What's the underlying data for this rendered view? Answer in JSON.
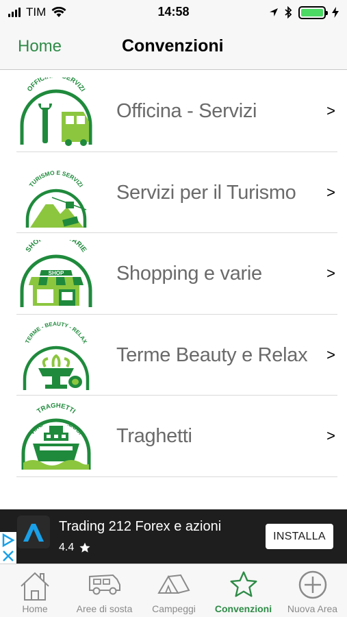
{
  "status_bar": {
    "carrier": "TIM",
    "time": "14:58",
    "battery_color": "#4cd964"
  },
  "nav": {
    "back_label": "Home",
    "title": "Convenzioni"
  },
  "list": {
    "items": [
      {
        "label": "Officina - Servizi",
        "logo_caption": "OFFICINA - SERVIZI",
        "icon": "wrench-truck-icon",
        "chevron": ">"
      },
      {
        "label": "Servizi per il Turismo",
        "logo_caption": "TURISMO E SERVIZI",
        "icon": "mountain-cablecar-icon",
        "chevron": ">"
      },
      {
        "label": "Shopping e varie",
        "logo_caption": "SHOPPING E VARIE",
        "shop_sign": "SHOP",
        "icon": "shop-icon",
        "chevron": ">"
      },
      {
        "label": "Terme Beauty e Relax",
        "logo_caption": "TERME - BEAUTY - RELAX",
        "icon": "fountain-towels-icon",
        "chevron": ">"
      },
      {
        "label": "Traghetti",
        "logo_caption": "TRAGHETTI",
        "icon": "ferry-icon",
        "chevron": ">"
      }
    ],
    "partial_logo_caption": "VIAGGI & NOLEGGI"
  },
  "ad": {
    "title": "Trading 212 Forex e azioni",
    "rating": "4.4",
    "button": "INSTALLA",
    "accent": "#1aa0e8"
  },
  "tabs": [
    {
      "label": "Home",
      "icon": "house-icon",
      "active": false
    },
    {
      "label": "Aree di sosta",
      "icon": "camper-icon",
      "active": false
    },
    {
      "label": "Campeggi",
      "icon": "tents-icon",
      "active": false
    },
    {
      "label": "Convenzioni",
      "icon": "star-icon",
      "active": true
    },
    {
      "label": "Nuova Area",
      "icon": "plus-circle-icon",
      "active": false
    }
  ],
  "colors": {
    "brand_green": "#2e8b47",
    "logo_green": "#1f8a3c",
    "logo_light_green": "#8cc63f"
  }
}
